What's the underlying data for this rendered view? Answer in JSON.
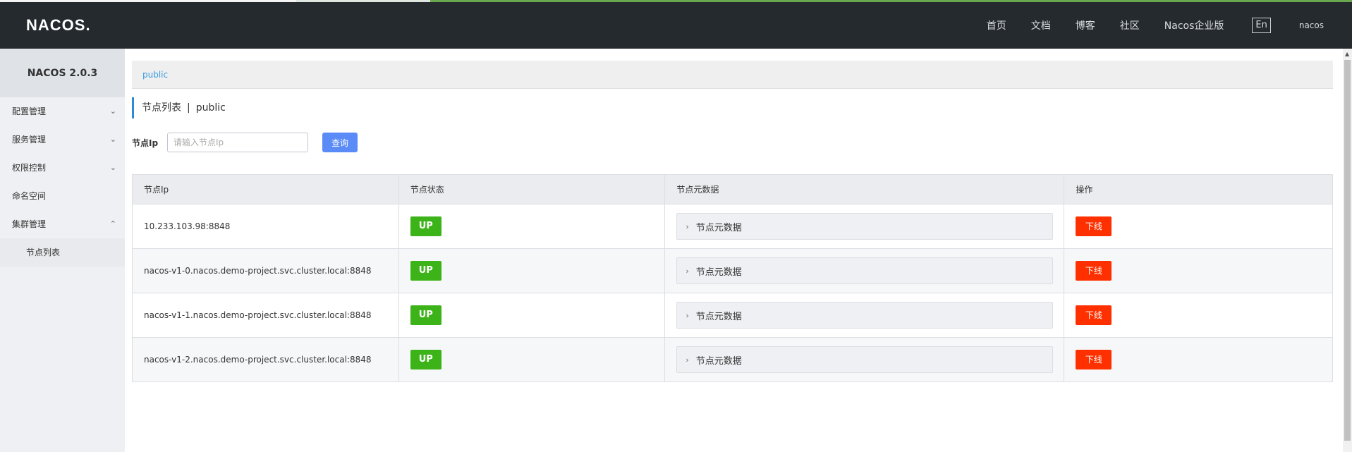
{
  "header": {
    "logo": "NACOS.",
    "nav": [
      "首页",
      "文档",
      "博客",
      "社区",
      "Nacos企业版"
    ],
    "lang": "En",
    "user": "nacos"
  },
  "sidebar": {
    "version": "NACOS 2.0.3",
    "items": [
      {
        "label": "配置管理",
        "expanded": false
      },
      {
        "label": "服务管理",
        "expanded": false
      },
      {
        "label": "权限控制",
        "expanded": false
      },
      {
        "label": "命名空间"
      },
      {
        "label": "集群管理",
        "expanded": true
      }
    ],
    "sub_item": "节点列表"
  },
  "namespace": "public",
  "page": {
    "title": "节点列表",
    "separator": "|",
    "namespace": "public"
  },
  "filter": {
    "label": "节点Ip",
    "placeholder": "请输入节点Ip",
    "query_button": "查询"
  },
  "table": {
    "headers": [
      "节点Ip",
      "节点状态",
      "节点元数据",
      "操作"
    ],
    "rows": [
      {
        "ip": "10.233.103.98:8848",
        "status": "UP",
        "meta": "节点元数据",
        "action": "下线"
      },
      {
        "ip": "nacos-v1-0.nacos.demo-project.svc.cluster.local:8848",
        "status": "UP",
        "meta": "节点元数据",
        "action": "下线"
      },
      {
        "ip": "nacos-v1-1.nacos.demo-project.svc.cluster.local:8848",
        "status": "UP",
        "meta": "节点元数据",
        "action": "下线"
      },
      {
        "ip": "nacos-v1-2.nacos.demo-project.svc.cluster.local:8848",
        "status": "UP",
        "meta": "节点元数据",
        "action": "下线"
      }
    ]
  },
  "icons": {
    "chevron_down": "chevron-down-icon",
    "chevron_up": "chevron-up-icon",
    "chevron_right": "chevron-right-icon"
  },
  "colors": {
    "header_bg": "#252a2f",
    "primary": "#5a8bf6",
    "status_up": "#3cb318",
    "offline": "#ff3000",
    "link": "#3b9be0"
  }
}
